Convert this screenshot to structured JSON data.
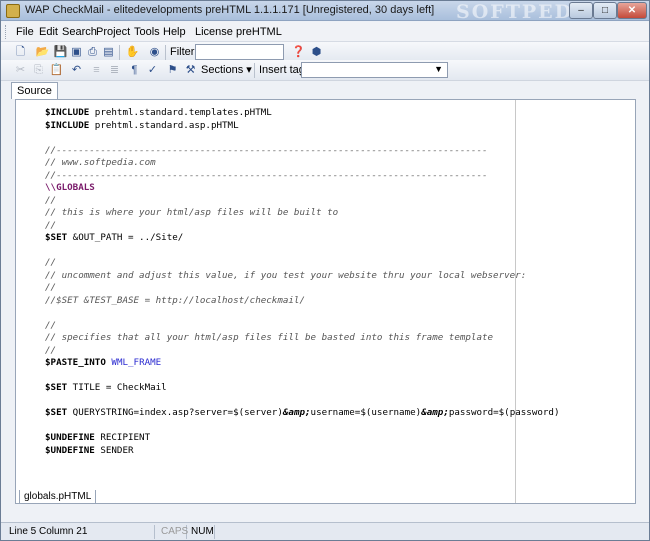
{
  "window": {
    "title": "WAP CheckMail - elitedevelopments preHTML 1.1.1.171 [Unregistered, 30 days left]",
    "watermark": "SOFTPEDIA",
    "minimize": "–",
    "maximize": "□",
    "close": "✕"
  },
  "menu": [
    "File",
    "Edit",
    "Search",
    "Project",
    "Tools",
    "Help",
    "License preHTML"
  ],
  "toolbar": {
    "filter_label": "Filter:",
    "filter_value": "",
    "sections_label": "Sections ▾",
    "insert_tag_label": "Insert tag:",
    "insert_tag_value": "",
    "icons": {
      "new": "new-file-icon",
      "open": "open-folder-icon",
      "save": "save-icon",
      "save_all": "save-all-icon",
      "help": "help-icon",
      "cut": "cut-icon",
      "copy": "copy-icon",
      "paste": "paste-icon",
      "undo": "undo-icon",
      "indent": "indent-icon",
      "outdent": "outdent-icon",
      "paragraph": "paragraph-icon",
      "spell": "spellcheck-icon"
    }
  },
  "tabs": {
    "source": "Source",
    "document": "globals.pHTML"
  },
  "code_lines": [
    [
      {
        "t": "$INCLUDE",
        "c": "kw"
      },
      {
        "t": " prehtml.standard.templates.pHTML",
        "c": ""
      }
    ],
    [
      {
        "t": "$INCLUDE",
        "c": "kw"
      },
      {
        "t": " prehtml.standard.asp.pHTML",
        "c": ""
      }
    ],
    [
      {
        "t": "",
        "c": ""
      }
    ],
    [
      {
        "t": "//------------------------------------------------------------------------------",
        "c": "cm"
      }
    ],
    [
      {
        "t": "// www.softpedia.com",
        "c": "cm"
      }
    ],
    [
      {
        "t": "//------------------------------------------------------------------------------",
        "c": "cm"
      }
    ],
    [
      {
        "t": "\\\\GLOBALS",
        "c": "pu"
      }
    ],
    [
      {
        "t": "//",
        "c": "cm"
      }
    ],
    [
      {
        "t": "// this is where your html/asp files will be built to",
        "c": "cm"
      }
    ],
    [
      {
        "t": "//",
        "c": "cm"
      }
    ],
    [
      {
        "t": "$SET",
        "c": "kw"
      },
      {
        "t": " &OUT_PATH = ../Site/",
        "c": ""
      }
    ],
    [
      {
        "t": "",
        "c": ""
      }
    ],
    [
      {
        "t": "//",
        "c": "cm"
      }
    ],
    [
      {
        "t": "// uncomment and adjust this value, if you test your website thru your local webserver:",
        "c": "cm"
      }
    ],
    [
      {
        "t": "//",
        "c": "cm"
      }
    ],
    [
      {
        "t": "//$SET &TEST_BASE = http://localhost/checkmail/",
        "c": "cm"
      }
    ],
    [
      {
        "t": "",
        "c": ""
      }
    ],
    [
      {
        "t": "//",
        "c": "cm"
      }
    ],
    [
      {
        "t": "// specifies that all your html/asp files fill be basted into this frame template",
        "c": "cm"
      }
    ],
    [
      {
        "t": "//",
        "c": "cm"
      }
    ],
    [
      {
        "t": "$PASTE_INTO",
        "c": "kw"
      },
      {
        "t": " ",
        "c": ""
      },
      {
        "t": "WML_FRAME",
        "c": "id"
      }
    ],
    [
      {
        "t": "",
        "c": ""
      }
    ],
    [
      {
        "t": "$SET",
        "c": "kw"
      },
      {
        "t": " TITLE = CheckMail",
        "c": ""
      }
    ],
    [
      {
        "t": "",
        "c": ""
      }
    ],
    [
      {
        "t": "$SET",
        "c": "kw"
      },
      {
        "t": " QUERYSTRING=index.asp?server=$(server)",
        "c": ""
      },
      {
        "t": "&amp;",
        "c": "en"
      },
      {
        "t": "username=$(username)",
        "c": ""
      },
      {
        "t": "&amp;",
        "c": "en"
      },
      {
        "t": "password=$(password)",
        "c": ""
      }
    ],
    [
      {
        "t": "",
        "c": ""
      }
    ],
    [
      {
        "t": "$UNDEFINE",
        "c": "kw"
      },
      {
        "t": " RECIPIENT",
        "c": ""
      }
    ],
    [
      {
        "t": "$UNDEFINE",
        "c": "kw"
      },
      {
        "t": " SENDER",
        "c": ""
      }
    ]
  ],
  "status": {
    "position": "Line 5 Column 21",
    "caps": "CAPS",
    "num": "NUM"
  }
}
